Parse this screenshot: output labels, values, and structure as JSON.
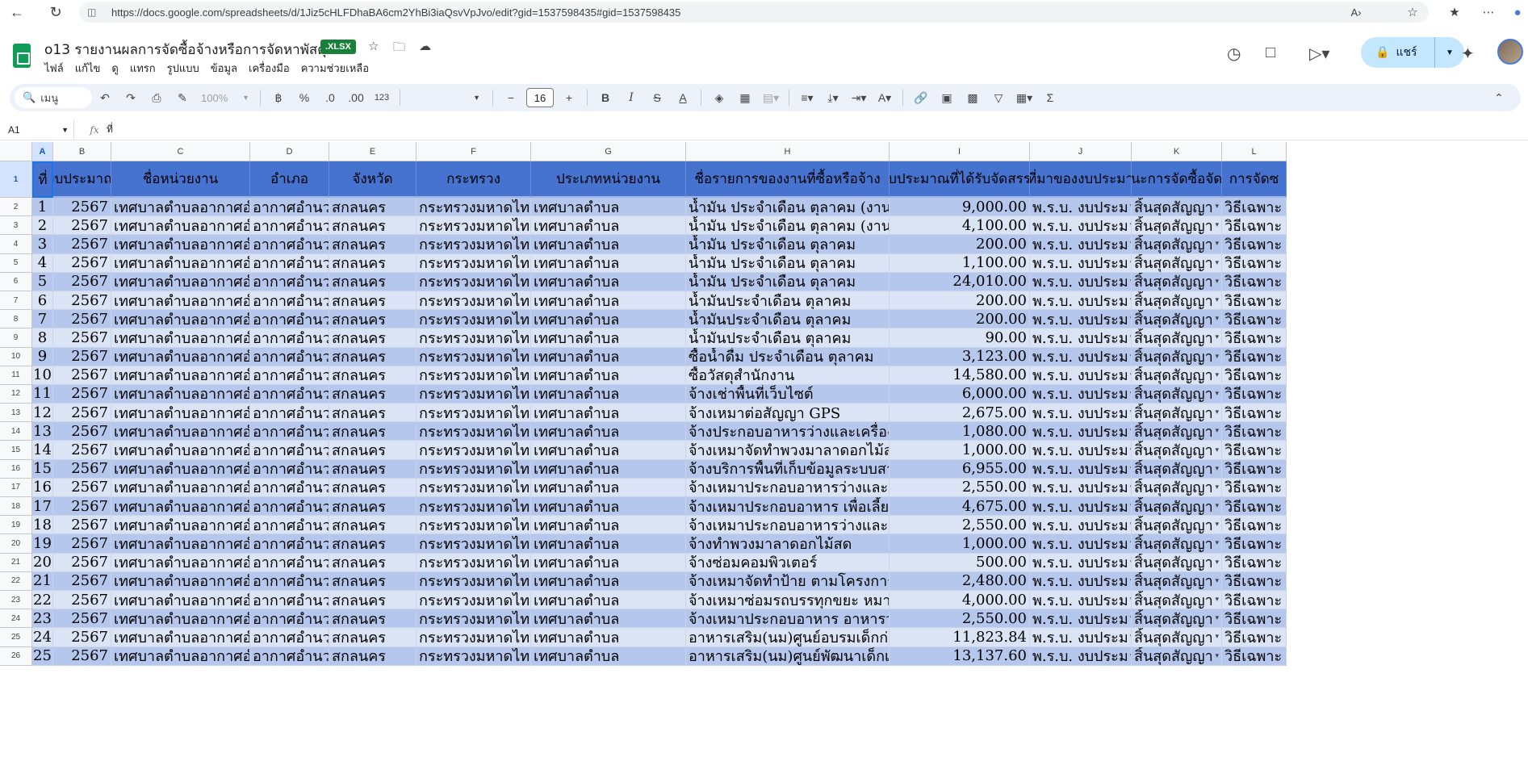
{
  "browser": {
    "url": "https://docs.google.com/spreadsheets/d/1Jiz5cHLFDhaBA6cm2YhBi3iaQsvVpJvo/edit?gid=1537598435#gid=1537598435"
  },
  "doc": {
    "title": "o13 รายงานผลการจัดซื้อจ้างหรือการจัดหาพัสดุ",
    "badge": ".XLSX",
    "menu": [
      "ไฟล์",
      "แก้ไข",
      "ดู",
      "แทรก",
      "รูปแบบ",
      "ข้อมูล",
      "เครื่องมือ",
      "ความช่วยเหลือ"
    ],
    "share_label": "แชร์"
  },
  "toolbar": {
    "search_label": "เมนู",
    "zoom": "100%",
    "currency": "฿",
    "percent": "%",
    "dec_decrease": ".0",
    "dec_increase": ".00",
    "number_format": "123",
    "font_size": "16"
  },
  "formula": {
    "cell_ref": "A1",
    "value": "ที่"
  },
  "grid": {
    "col_letters": [
      "A",
      "B",
      "C",
      "D",
      "E",
      "F",
      "G",
      "H",
      "I",
      "J",
      "K",
      "L"
    ],
    "row_numbers": [
      "1",
      "2",
      "3",
      "4",
      "5",
      "6",
      "7",
      "8",
      "9",
      "10",
      "11",
      "12",
      "13",
      "14",
      "15",
      "16",
      "17",
      "18",
      "19",
      "20",
      "21",
      "22",
      "23",
      "24",
      "25",
      "26"
    ],
    "headers": [
      "ที่",
      "งบประมาณ",
      "ชื่อหน่วยงาน",
      "อำเภอ",
      "จังหวัด",
      "กระทรวง",
      "ประเภทหน่วยงาน",
      "ชื่อรายการของงานที่ซื้อหรือจ้าง",
      "บประมาณที่ได้รับจัดสรร",
      "ที่มาของงบประมา",
      "นะการจัดซื้อจัด",
      "การจัดซ"
    ],
    "rows": [
      [
        "1",
        "2567",
        "เทศบาลตำบลอากาศอำ",
        "อากาศอำนวย",
        "สกลนคร",
        "กระทรวงมหาดไทย",
        "เทศบาลตำบล",
        "น้ำมัน ประจำเดือน ตุลาคม (งานบริห",
        "9,000.00",
        "พ.ร.บ. งบประม",
        "สิ้นสุดสัญญา",
        "วิธีเฉพาะ"
      ],
      [
        "2",
        "2567",
        "เทศบาลตำบลอากาศอำ",
        "อากาศอำนวย",
        "สกลนคร",
        "กระทรวงมหาดไทย",
        "เทศบาลตำบล",
        "น้ำมัน ประจำเดือน ตุลาคม (งานป้อง",
        "4,100.00",
        "พ.ร.บ. งบประม",
        "สิ้นสุดสัญญา",
        "วิธีเฉพาะ"
      ],
      [
        "3",
        "2567",
        "เทศบาลตำบลอากาศอำ",
        "อากาศอำนวย",
        "สกลนคร",
        "กระทรวงมหาดไทย",
        "เทศบาลตำบล",
        "น้ำมัน ประจำเดือน ตุลาคม",
        "200.00",
        "พ.ร.บ. งบประม",
        "สิ้นสุดสัญญา",
        "วิธีเฉพาะ"
      ],
      [
        "4",
        "2567",
        "เทศบาลตำบลอากาศอำ",
        "อากาศอำนวย",
        "สกลนคร",
        "กระทรวงมหาดไทย",
        "เทศบาลตำบล",
        "น้ำมัน ประจำเดือน ตุลาคม",
        "1,100.00",
        "พ.ร.บ. งบประม",
        "สิ้นสุดสัญญา",
        "วิธีเฉพาะ"
      ],
      [
        "5",
        "2567",
        "เทศบาลตำบลอากาศอำ",
        "อากาศอำนวย",
        "สกลนคร",
        "กระทรวงมหาดไทย",
        "เทศบาลตำบล",
        "น้ำมัน ประจำเดือน ตุลาคม",
        "24,010.00",
        "พ.ร.บ. งบประม",
        "สิ้นสุดสัญญา",
        "วิธีเฉพาะ"
      ],
      [
        "6",
        "2567",
        "เทศบาลตำบลอากาศอำ",
        "อากาศอำนวย",
        "สกลนคร",
        "กระทรวงมหาดไทย",
        "เทศบาลตำบล",
        "น้ำมันประจำเดือน ตุลาคม",
        "200.00",
        "พ.ร.บ. งบประม",
        "สิ้นสุดสัญญา",
        "วิธีเฉพาะ"
      ],
      [
        "7",
        "2567",
        "เทศบาลตำบลอากาศอำ",
        "อากาศอำนวย",
        "สกลนคร",
        "กระทรวงมหาดไทย",
        "เทศบาลตำบล",
        "น้ำมันประจำเดือน ตุลาคม",
        "200.00",
        "พ.ร.บ. งบประม",
        "สิ้นสุดสัญญา",
        "วิธีเฉพาะ"
      ],
      [
        "8",
        "2567",
        "เทศบาลตำบลอากาศอำ",
        "อากาศอำนวย",
        "สกลนคร",
        "กระทรวงมหาดไทย",
        "เทศบาลตำบล",
        "น้ำมันประจำเดือน ตุลาคม",
        "90.00",
        "พ.ร.บ. งบประม",
        "สิ้นสุดสัญญา",
        "วิธีเฉพาะ"
      ],
      [
        "9",
        "2567",
        "เทศบาลตำบลอากาศอำ",
        "อากาศอำนวย",
        "สกลนคร",
        "กระทรวงมหาดไทย",
        "เทศบาลตำบล",
        "ซื้อน้ำดื่ม ประจำเดือน ตุลาคม",
        "3,123.00",
        "พ.ร.บ. งบประม",
        "สิ้นสุดสัญญา",
        "วิธีเฉพาะ"
      ],
      [
        "10",
        "2567",
        "เทศบาลตำบลอากาศอำ",
        "อากาศอำนวย",
        "สกลนคร",
        "กระทรวงมหาดไทย",
        "เทศบาลตำบล",
        "ซื้อวัสดุสำนักงาน",
        "14,580.00",
        "พ.ร.บ. งบประม",
        "สิ้นสุดสัญญา",
        "วิธีเฉพาะ"
      ],
      [
        "11",
        "2567",
        "เทศบาลตำบลอากาศอำ",
        "อากาศอำนวย",
        "สกลนคร",
        "กระทรวงมหาดไทย",
        "เทศบาลตำบล",
        "จ้างเช่าพื้นที่เว็บไซต์",
        "6,000.00",
        "พ.ร.บ. งบประม",
        "สิ้นสุดสัญญา",
        "วิธีเฉพาะ"
      ],
      [
        "12",
        "2567",
        "เทศบาลตำบลอากาศอำ",
        "อากาศอำนวย",
        "สกลนคร",
        "กระทรวงมหาดไทย",
        "เทศบาลตำบล",
        "จ้างเหมาต่อสัญญา GPS",
        "2,675.00",
        "พ.ร.บ. งบประม",
        "สิ้นสุดสัญญา",
        "วิธีเฉพาะ"
      ],
      [
        "13",
        "2567",
        "เทศบาลตำบลอากาศอำ",
        "อากาศอำนวย",
        "สกลนคร",
        "กระทรวงมหาดไทย",
        "เทศบาลตำบล",
        "จ้างประกอบอาหารว่างและเครื่องดื่ม",
        "1,080.00",
        "พ.ร.บ. งบประม",
        "สิ้นสุดสัญญา",
        "วิธีเฉพาะ"
      ],
      [
        "14",
        "2567",
        "เทศบาลตำบลอากาศอำ",
        "อากาศอำนวย",
        "สกลนคร",
        "กระทรวงมหาดไทย",
        "เทศบาลตำบล",
        "จ้างเหมาจัดทำพวงมาลาดอกไม้สด",
        "1,000.00",
        "พ.ร.บ. งบประม",
        "สิ้นสุดสัญญา",
        "วิธีเฉพาะ"
      ],
      [
        "15",
        "2567",
        "เทศบาลตำบลอากาศอำ",
        "อากาศอำนวย",
        "สกลนคร",
        "กระทรวงมหาดไทย",
        "เทศบาลตำบล",
        "จ้างบริการพื้นที่เก็บข้อมูลระบบสารส",
        "6,955.00",
        "พ.ร.บ. งบประม",
        "สิ้นสุดสัญญา",
        "วิธีเฉพาะ"
      ],
      [
        "16",
        "2567",
        "เทศบาลตำบลอากาศอำ",
        "อากาศอำนวย",
        "สกลนคร",
        "กระทรวงมหาดไทย",
        "เทศบาลตำบล",
        "จ้างเหมาประกอบอาหารว่างและเครื่",
        "2,550.00",
        "พ.ร.บ. งบประม",
        "สิ้นสุดสัญญา",
        "วิธีเฉพาะ"
      ],
      [
        "17",
        "2567",
        "เทศบาลตำบลอากาศอำ",
        "อากาศอำนวย",
        "สกลนคร",
        "กระทรวงมหาดไทย",
        "เทศบาลตำบล",
        "จ้างเหมาประกอบอาหาร เพื่อเลี้ยงอ",
        "4,675.00",
        "พ.ร.บ. งบประม",
        "สิ้นสุดสัญญา",
        "วิธีเฉพาะ"
      ],
      [
        "18",
        "2567",
        "เทศบาลตำบลอากาศอำ",
        "อากาศอำนวย",
        "สกลนคร",
        "กระทรวงมหาดไทย",
        "เทศบาลตำบล",
        "จ้างเหมาประกอบอาหารว่างและเครื่",
        "2,550.00",
        "พ.ร.บ. งบประม",
        "สิ้นสุดสัญญา",
        "วิธีเฉพาะ"
      ],
      [
        "19",
        "2567",
        "เทศบาลตำบลอากาศอำ",
        "อากาศอำนวย",
        "สกลนคร",
        "กระทรวงมหาดไทย",
        "เทศบาลตำบล",
        "จ้างทำพวงมาลาดอกไม้สด",
        "1,000.00",
        "พ.ร.บ. งบประม",
        "สิ้นสุดสัญญา",
        "วิธีเฉพาะ"
      ],
      [
        "20",
        "2567",
        "เทศบาลตำบลอากาศอำ",
        "อากาศอำนวย",
        "สกลนคร",
        "กระทรวงมหาดไทย",
        "เทศบาลตำบล",
        "จ้างซ่อมคอมพิวเตอร์",
        "500.00",
        "พ.ร.บ. งบประม",
        "สิ้นสุดสัญญา",
        "วิธีเฉพาะ"
      ],
      [
        "21",
        "2567",
        "เทศบาลตำบลอากาศอำ",
        "อากาศอำนวย",
        "สกลนคร",
        "กระทรวงมหาดไทย",
        "เทศบาลตำบล",
        "จ้างเหมาจัดทำป้าย ตามโครงการจัด",
        "2,480.00",
        "พ.ร.บ. งบประม",
        "สิ้นสุดสัญญา",
        "วิธีเฉพาะ"
      ],
      [
        "22",
        "2567",
        "เทศบาลตำบลอากาศอำ",
        "อากาศอำนวย",
        "สกลนคร",
        "กระทรวงมหาดไทย",
        "เทศบาลตำบล",
        "จ้างเหมาซ่อมรถบรรทุกขยะ หมายเล",
        "4,000.00",
        "พ.ร.บ. งบประม",
        "สิ้นสุดสัญญา",
        "วิธีเฉพาะ"
      ],
      [
        "23",
        "2567",
        "เทศบาลตำบลอากาศอำ",
        "อากาศอำนวย",
        "สกลนคร",
        "กระทรวงมหาดไทย",
        "เทศบาลตำบล",
        "จ้างเหมาประกอบอาหาร อาหารว่าง",
        "2,550.00",
        "พ.ร.บ. งบประม",
        "สิ้นสุดสัญญา",
        "วิธีเฉพาะ"
      ],
      [
        "24",
        "2567",
        "เทศบาลตำบลอากาศอำ",
        "อากาศอำนวย",
        "สกลนคร",
        "กระทรวงมหาดไทย",
        "เทศบาลตำบล",
        "อาหารเสริม(นม)ศูนย์อบรมเด็กก่อนเ",
        "11,823.84",
        "พ.ร.บ. งบประม",
        "สิ้นสุดสัญญา",
        "วิธีเฉพาะ"
      ],
      [
        "25",
        "2567",
        "เทศบาลตำบลอากาศอำ",
        "อากาศอำนวย",
        "สกลนคร",
        "กระทรวงมหาดไทย",
        "เทศบาลตำบล",
        "อาหารเสริม(นม)ศูนย์พัฒนาเด็กเล็ก",
        "13,137.60",
        "พ.ร.บ. งบประม",
        "สิ้นสุดสัญญา",
        "วิธีเฉพาะ"
      ]
    ]
  }
}
